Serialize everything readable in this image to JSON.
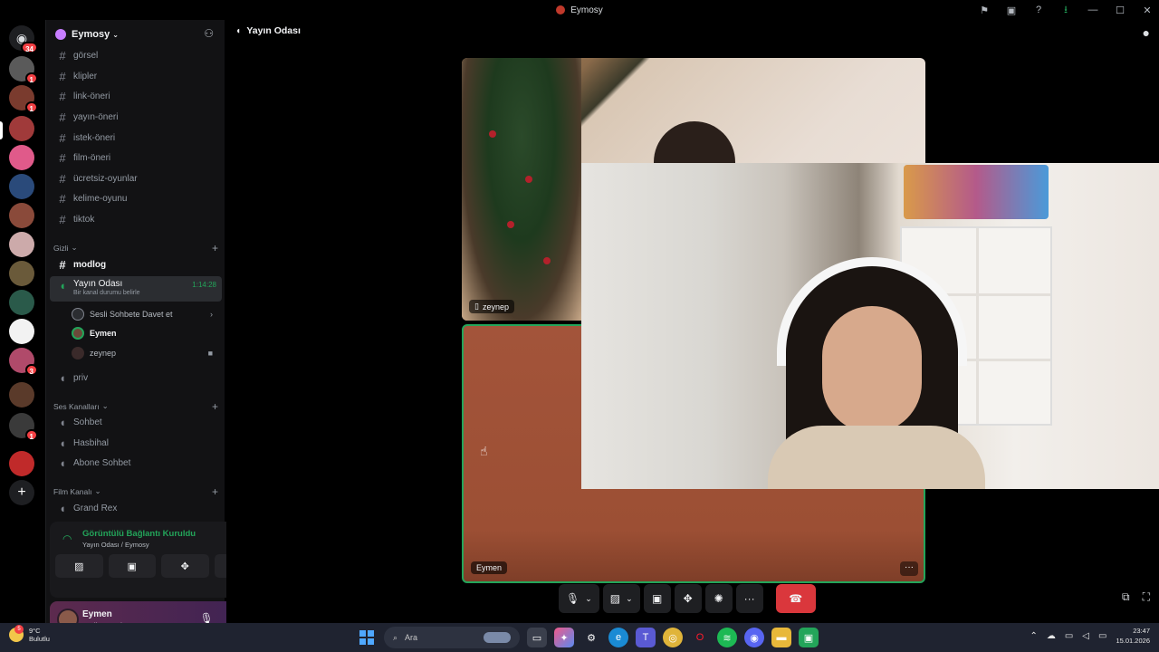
{
  "window": {
    "title": "Eymosy"
  },
  "guild": {
    "name": "Eymosy"
  },
  "text_channels": [
    "görsel",
    "klipler",
    "link-öneri",
    "yayın-öneri",
    "istek-öneri",
    "film-öneri",
    "ücretsiz-oyunlar",
    "kelime-oyunu",
    "tiktok"
  ],
  "categories": {
    "hidden": "Gizli",
    "voice": "Ses Kanalları",
    "film": "Film Kanalı"
  },
  "hidden_channel": "modlog",
  "active_voice": {
    "name": "Yayın Odası",
    "timer": "1:14:28",
    "status_hint": "Bir kanal durumu belirle"
  },
  "voice_invite": "Sesli Sohbete Davet et",
  "voice_users": [
    {
      "name": "Eymen"
    },
    {
      "name": "zeynep"
    }
  ],
  "priv_channel": "priv",
  "voice_channels": [
    "Sohbet",
    "Hasbihal",
    "Abone Sohbet"
  ],
  "film_channels": [
    "Grand Rex"
  ],
  "server_badges": [
    "34",
    "1",
    "1",
    "3",
    "1"
  ],
  "connection": {
    "status": "Görüntülü Bağlantı Kuruldu",
    "location": "Yayın Odası / Eymosy"
  },
  "user": {
    "name": "Eymen",
    "state": "Sesli aramada •"
  },
  "stage": {
    "header": "Yayın Odası",
    "tiles": [
      {
        "name": "zeynep"
      },
      {
        "name": "Eymen"
      }
    ]
  },
  "callbar": {
    "more": "···"
  },
  "taskbar": {
    "weather_temp": "9°C",
    "weather_desc": "Bulutlu",
    "weather_badge": "5",
    "search_placeholder": "Ara",
    "time": "23:47",
    "date": "15.01.2026"
  }
}
